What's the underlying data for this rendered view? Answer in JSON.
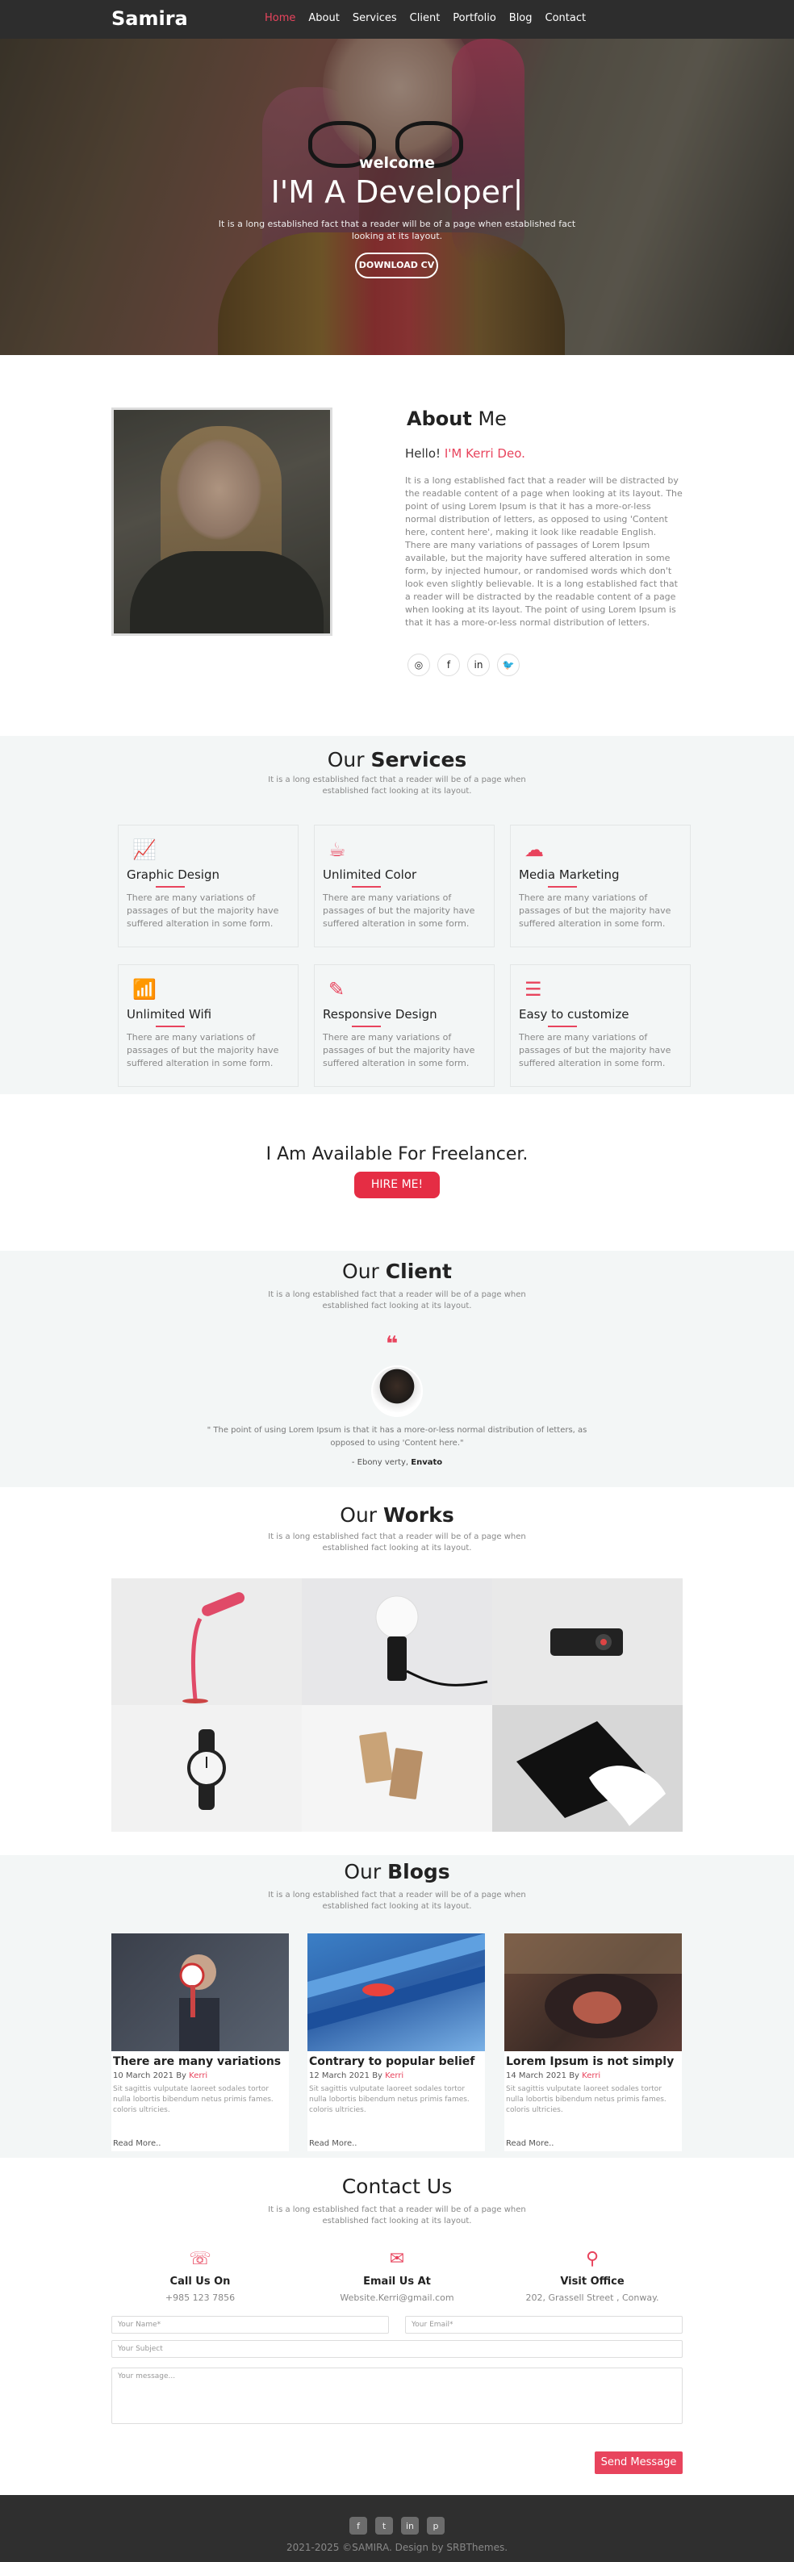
{
  "nav": {
    "brand": "Samira",
    "items": [
      "Home",
      "About",
      "Services",
      "Client",
      "Portfolio",
      "Blog",
      "Contact"
    ],
    "active": "Home",
    "accent": "#e8445d"
  },
  "hero": {
    "welcome": "welcome",
    "title": "I'M A Developer|",
    "subtitle": "It is a long established fact that a reader will be of a page when established fact looking at its layout.",
    "button": "DOWNLOAD CV"
  },
  "about": {
    "heading_a": "About",
    "heading_b": "Me",
    "hello": "Hello!",
    "name": "I'M Kerri Deo.",
    "text": "It is a long established fact that a reader will be distracted by the readable content of a page when looking at its layout. The point of using Lorem Ipsum is that it has a more-or-less normal distribution of letters, as opposed to using 'Content here, content here', making it look like readable English. There are many variations of passages of Lorem Ipsum available, but the majority have suffered alteration in some form, by injected humour, or randomised words which don't look even slightly believable. It is a long established fact that a reader will be distracted by the readable content of a page when looking at its layout. The point of using Lorem Ipsum is that it has a more-or-less normal distribution of letters.",
    "socials": [
      "dribbble-icon",
      "facebook-icon",
      "linkedin-icon",
      "twitter-icon"
    ]
  },
  "services": {
    "heading_a": "Our",
    "heading_b": "Services",
    "subtitle": "It is a long established fact that a reader will be of a page when established fact looking at its layout.",
    "items": [
      {
        "title": "Graphic Design",
        "icon": "chart-icon",
        "text": "There are many variations of passages of but the majority have suffered alteration in some form."
      },
      {
        "title": "Unlimited Color",
        "icon": "mug-icon",
        "text": "There are many variations of passages of but the majority have suffered alteration in some form."
      },
      {
        "title": "Media Marketing",
        "icon": "cloud-upload-icon",
        "text": "There are many variations of passages of but the majority have suffered alteration in some form."
      },
      {
        "title": "Unlimited Wifi",
        "icon": "wifi-icon",
        "text": "There are many variations of passages of but the majority have suffered alteration in some form."
      },
      {
        "title": "Responsive Design",
        "icon": "edit-icon",
        "text": "There are many variations of passages of but the majority have suffered alteration in some form."
      },
      {
        "title": "Easy to customize",
        "icon": "layers-icon",
        "text": "There are many variations of passages of but the majority have suffered alteration in some form."
      }
    ]
  },
  "freelance": {
    "heading": "I Am Available For Freelancer.",
    "button": "HIRE ME!"
  },
  "client": {
    "heading_a": "Our",
    "heading_b": "Client",
    "subtitle": "It is a long established fact that a reader will be of a page when established fact looking at its layout.",
    "quote": "\" The point of using Lorem Ipsum is that it has a more-or-less normal distribution of letters, as opposed to using 'Content here.\"",
    "by_prefix": "- Ebony verty,",
    "by_company": "Envato"
  },
  "works": {
    "heading_a": "Our",
    "heading_b": "Works",
    "subtitle": "It is a long established fact that a reader will be of a page when established fact looking at its layout."
  },
  "blogs": {
    "heading_a": "Our",
    "heading_b": "Blogs",
    "subtitle": "It is a long established fact that a reader will be of a page when established fact looking at its layout.",
    "posts": [
      {
        "title": "There are many variations",
        "date": "10 March 2021 By",
        "author": "Kerri",
        "text": "Sit sagittis vulputate laoreet sodales tortor nulla lobortis bibendum netus primis fames. coloris ultricies.",
        "more": "Read More.."
      },
      {
        "title": "Contrary to popular belief",
        "date": "12 March 2021 By",
        "author": "Kerri",
        "text": "Sit sagittis vulputate laoreet sodales tortor nulla lobortis bibendum netus primis fames. coloris ultricies.",
        "more": "Read More.."
      },
      {
        "title": "Lorem Ipsum is not simply",
        "date": "14 March 2021 By",
        "author": "Kerri",
        "text": "Sit sagittis vulputate laoreet sodales tortor nulla lobortis bibendum netus primis fames. coloris ultricies.",
        "more": "Read More.."
      }
    ]
  },
  "contact": {
    "heading": "Contact Us",
    "subtitle": "It is a long established fact that a reader will be of a page when established fact looking at its layout.",
    "info": [
      {
        "label": "Call Us On",
        "value": "+985 123 7856",
        "icon": "phone-icon"
      },
      {
        "label": "Email Us At",
        "value": "Website.Kerri@gmail.com",
        "icon": "mail-icon"
      },
      {
        "label": "Visit Office",
        "value": "202, Grassell Street , Conway.",
        "icon": "location-icon"
      }
    ],
    "name_placeholder": "Your Name*",
    "email_placeholder": "Your Email*",
    "subject_placeholder": "Your Subject",
    "message_placeholder": "Your message...",
    "send": "Send Message"
  },
  "footer": {
    "icons": [
      "facebook-icon",
      "twitter-icon",
      "linkedin-icon",
      "pinterest-icon"
    ],
    "copyright": "2021-2025 ©SAMIRA. Design by SRBThemes."
  }
}
